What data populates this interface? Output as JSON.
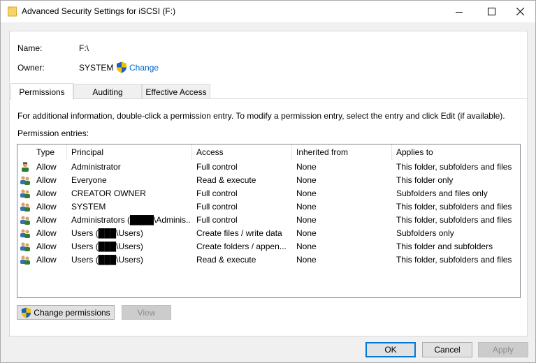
{
  "window": {
    "title": "Advanced Security Settings for iSCSI (F:)"
  },
  "info": {
    "name_label": "Name:",
    "name_value": "F:\\",
    "owner_label": "Owner:",
    "owner_value": "SYSTEM",
    "change_link": "Change"
  },
  "tabs": [
    {
      "label": "Permissions",
      "active": true
    },
    {
      "label": "Auditing",
      "active": false
    },
    {
      "label": "Effective Access",
      "active": false
    }
  ],
  "instructions": "For additional information, double-click a permission entry. To modify a permission entry, select the entry and click Edit (if available).",
  "entries_label": "Permission entries:",
  "columns": [
    "Type",
    "Principal",
    "Access",
    "Inherited from",
    "Applies to"
  ],
  "rows": [
    {
      "icon": "user-icon",
      "type": "Allow",
      "principal": "Administrator",
      "access": "Full control",
      "inherited": "None",
      "applies": "This folder, subfolders and files"
    },
    {
      "icon": "users-icon",
      "type": "Allow",
      "principal": "Everyone",
      "access": "Read & execute",
      "inherited": "None",
      "applies": "This folder only"
    },
    {
      "icon": "users-icon",
      "type": "Allow",
      "principal": "CREATOR OWNER",
      "access": "Full control",
      "inherited": "None",
      "applies": "Subfolders and files only"
    },
    {
      "icon": "users-icon",
      "type": "Allow",
      "principal": "SYSTEM",
      "access": "Full control",
      "inherited": "None",
      "applies": "This folder, subfolders and files"
    },
    {
      "icon": "users-icon",
      "type": "Allow",
      "principal": "Administrators (████\\Adminis...",
      "access": "Full control",
      "inherited": "None",
      "applies": "This folder, subfolders and files"
    },
    {
      "icon": "users-icon",
      "type": "Allow",
      "principal": "Users (███\\Users)",
      "access": "Create files / write data",
      "inherited": "None",
      "applies": "Subfolders only"
    },
    {
      "icon": "users-icon",
      "type": "Allow",
      "principal": "Users (███\\Users)",
      "access": "Create folders / appen...",
      "inherited": "None",
      "applies": "This folder and subfolders"
    },
    {
      "icon": "users-icon",
      "type": "Allow",
      "principal": "Users (███\\Users)",
      "access": "Read & execute",
      "inherited": "None",
      "applies": "This folder, subfolders and files"
    }
  ],
  "buttons": {
    "change_permissions": "Change permissions",
    "view": "View",
    "ok": "OK",
    "cancel": "Cancel",
    "apply": "Apply"
  },
  "colors": {
    "link": "#0066cc",
    "accent": "#0078d7"
  }
}
